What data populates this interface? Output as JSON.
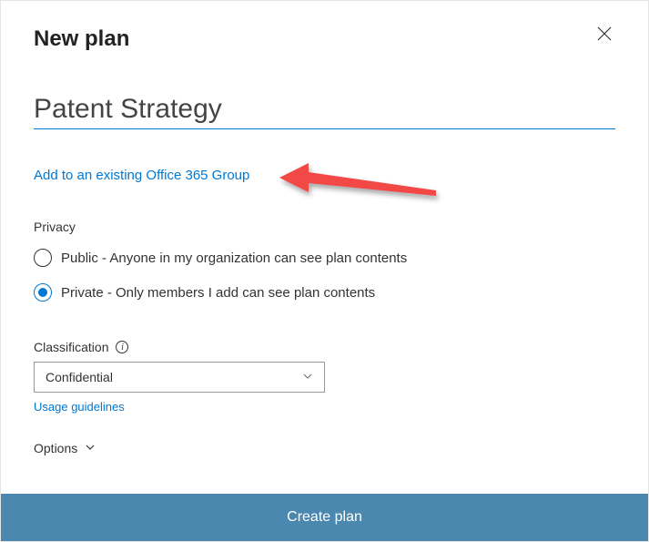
{
  "dialog": {
    "title": "New plan",
    "planName": "Patent Strategy",
    "groupLink": "Add to an existing Office 365 Group"
  },
  "privacy": {
    "label": "Privacy",
    "options": [
      {
        "label": "Public - Anyone in my organization can see plan contents",
        "selected": false
      },
      {
        "label": "Private - Only members I add can see plan contents",
        "selected": true
      }
    ]
  },
  "classification": {
    "label": "Classification",
    "selected": "Confidential",
    "usageLink": "Usage guidelines"
  },
  "options": {
    "label": "Options"
  },
  "footer": {
    "createLabel": "Create plan"
  }
}
